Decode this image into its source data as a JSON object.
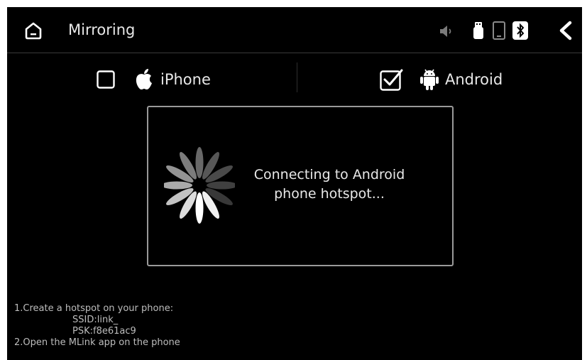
{
  "header": {
    "title": "Mirroring",
    "home_icon": "home-icon",
    "back_icon": "back-chevron-icon",
    "status_icons": [
      "volume-icon",
      "usb-icon",
      "phone-icon",
      "bluetooth-icon"
    ]
  },
  "options": {
    "iphone": {
      "label": "iPhone",
      "checked": false,
      "icon": "apple-icon"
    },
    "android": {
      "label": "Android",
      "checked": true,
      "icon": "android-icon"
    }
  },
  "dialog": {
    "line1": "Connecting to Android",
    "line2": "phone hotspot..."
  },
  "instructions": {
    "step1": "1.Create a hotspot on your phone:",
    "ssid": "SSID:link_",
    "psk": "PSK:f8e61ac9",
    "step2": "2.Open the MLink app on the phone"
  }
}
